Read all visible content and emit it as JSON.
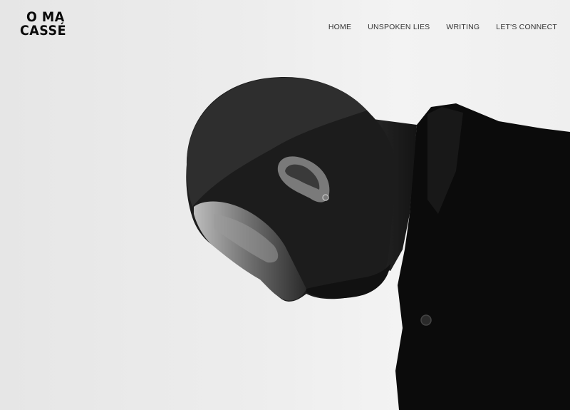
{
  "brand": {
    "logo_line_1": "O MA",
    "logo_line_2": "CASSÉ"
  },
  "nav": {
    "items": [
      {
        "label": "HOME"
      },
      {
        "label": "UNSPOKEN LIES"
      },
      {
        "label": "WRITING"
      },
      {
        "label": "LET'S CONNECT"
      }
    ]
  },
  "colors": {
    "background": "#ececec",
    "figure": "#0d0d0d",
    "text": "#333333"
  }
}
